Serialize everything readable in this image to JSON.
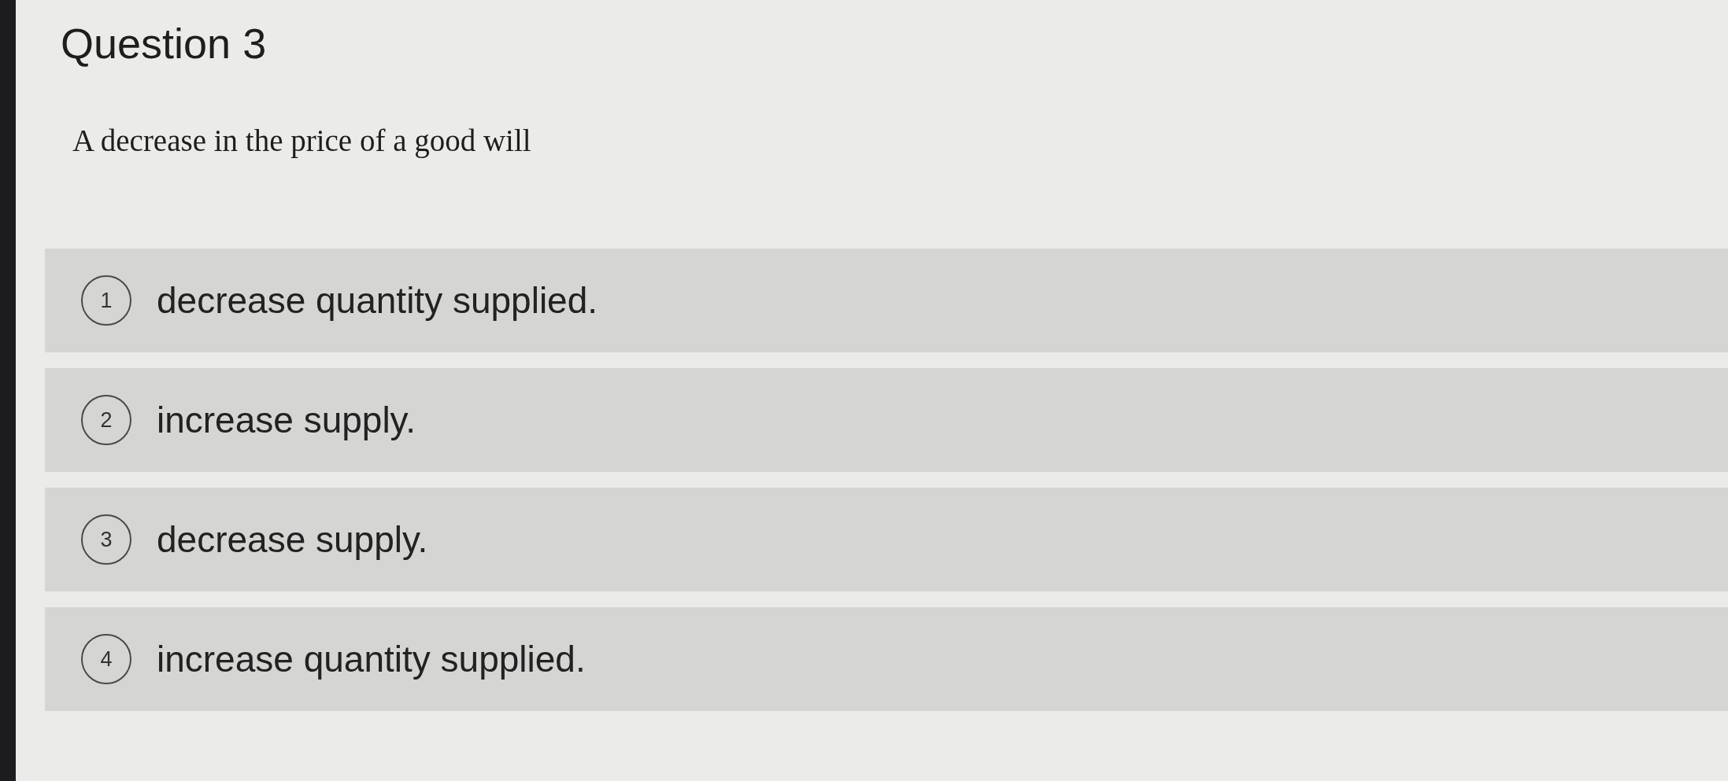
{
  "question": {
    "title": "Question 3",
    "prompt": "A decrease in the price of a good will"
  },
  "options": [
    {
      "number": "1",
      "text": "decrease quantity supplied."
    },
    {
      "number": "2",
      "text": "increase supply."
    },
    {
      "number": "3",
      "text": "decrease supply."
    },
    {
      "number": "4",
      "text": "increase quantity supplied."
    }
  ]
}
